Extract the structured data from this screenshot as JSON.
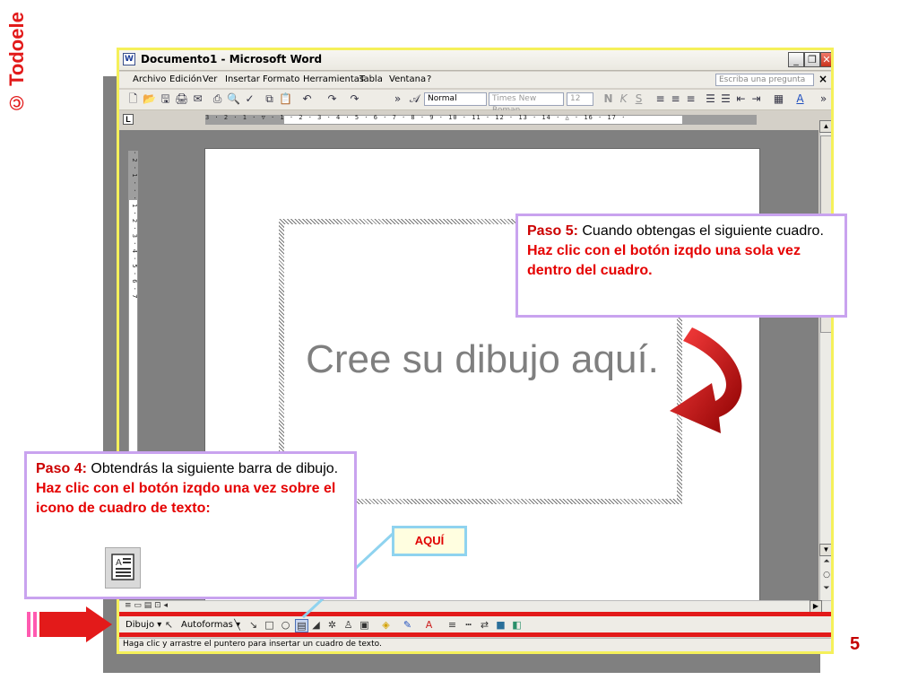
{
  "logo": {
    "text": "© Todoele"
  },
  "window": {
    "title": "Documento1 - Microsoft Word",
    "icon": "word-document-icon",
    "controls": {
      "minimize": "_",
      "restore": "❐",
      "close": "✕"
    }
  },
  "menu": {
    "items": [
      "Archivo",
      "Edición",
      "Ver",
      "Insertar",
      "Formato",
      "Herramientas",
      "Tabla",
      "Ventana",
      "?"
    ],
    "help_placeholder": "Escriba una pregunta",
    "help_close": "×"
  },
  "toolbar": {
    "style": "Normal",
    "font": "Times New Roman",
    "size": "12",
    "overflow": "»"
  },
  "ruler": {
    "horizontal": "3 · 2 · 1 · ▽ · 1 · 2 · 3 · 4 · 5 · 6 · 7 · 8 · 9 · 10 · 11 · 12 · 13 · 14 · △ · 16 · 17 ·",
    "vertical": "· 2 · 1 · · · 1 · 2 · 3 · 4 · 5 · 6 · 7",
    "tab_marker": "L"
  },
  "document": {
    "canvas_text": "Cree su dibujo aquí."
  },
  "drawing_toolbar": {
    "draw_menu": "Dibujo ▾",
    "autoshapes_menu": "Autoformas ▾"
  },
  "status": {
    "text": "Haga clic y arrastre el puntero para insertar un cuadro de texto."
  },
  "callout5": {
    "label": "Paso 5:",
    "text": " Cuando obtengas el siguiente cuadro.",
    "instruction": "Haz clic con el botón izqdo una sola vez dentro del cuadro."
  },
  "callout4": {
    "label": "Paso 4:",
    "text": " Obtendrás la siguiente barra de dibujo.",
    "instruction": "Haz clic con el botón izqdo una vez sobre el icono de cuadro de texto:"
  },
  "aqui": {
    "text": "AQUÍ"
  },
  "slide": {
    "number": "5"
  },
  "colors": {
    "highlight_red": "#e31a1a",
    "callout_border": "#c9a3ef",
    "window_border": "#f5f05a"
  }
}
